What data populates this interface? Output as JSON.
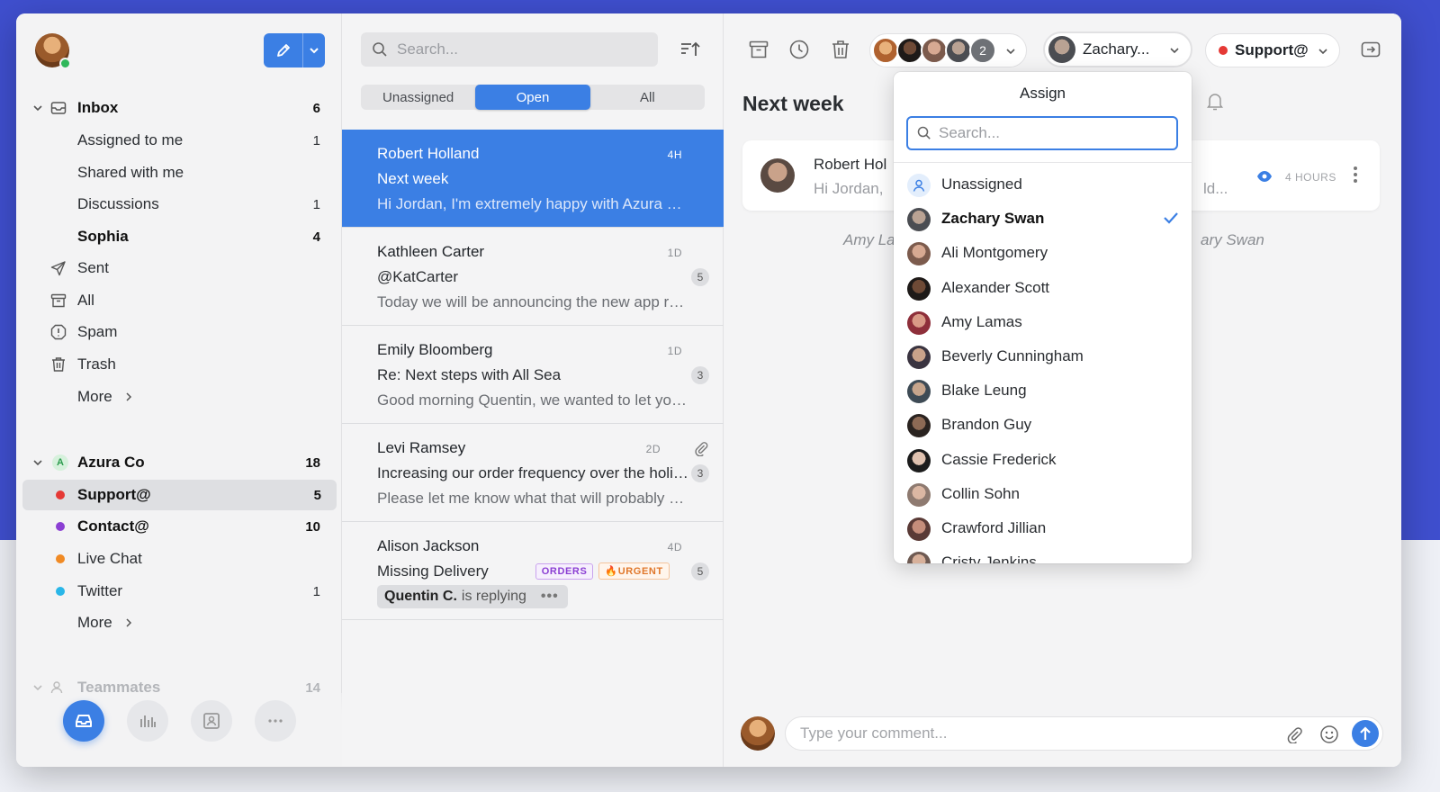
{
  "sidebar": {
    "inbox": {
      "label": "Inbox",
      "count": "6"
    },
    "items": [
      {
        "label": "Assigned to me",
        "count": "1"
      },
      {
        "label": "Shared with me",
        "count": ""
      },
      {
        "label": "Discussions",
        "count": "1"
      },
      {
        "label": "Sophia",
        "count": "4"
      },
      {
        "label": "Sent",
        "count": ""
      },
      {
        "label": "All",
        "count": ""
      },
      {
        "label": "Spam",
        "count": ""
      },
      {
        "label": "Trash",
        "count": ""
      },
      {
        "label": "More",
        "count": ""
      }
    ],
    "org": {
      "badge": "A",
      "label": "Azura Co",
      "count": "18"
    },
    "channels": [
      {
        "label": "Support@",
        "count": "5",
        "color": "#e53935"
      },
      {
        "label": "Contact@",
        "count": "10",
        "color": "#8b3fd3"
      },
      {
        "label": "Live Chat",
        "count": "",
        "color": "#f08a24"
      },
      {
        "label": "Twitter",
        "count": "1",
        "color": "#29b6e8"
      },
      {
        "label": "More",
        "count": ""
      }
    ],
    "teammates": {
      "label": "Teammates",
      "count": "14"
    }
  },
  "list": {
    "search_placeholder": "Search...",
    "tabs": [
      "Unassigned",
      "Open",
      "All"
    ],
    "conversations": [
      {
        "name": "Robert Holland",
        "time": "4H",
        "subject": "Next week",
        "preview": "Hi Jordan, I'm extremely happy with Azura Co and the team",
        "badge": ""
      },
      {
        "name": "Kathleen Carter",
        "time": "1D",
        "subject": "@KatCarter",
        "preview": "Today we will be announcing the new app release",
        "badge": "5"
      },
      {
        "name": "Emily Bloomberg",
        "time": "1D",
        "subject": "Re: Next steps with All Sea",
        "preview": "Good morning Quentin, we wanted to let you know",
        "badge": "3"
      },
      {
        "name": "Levi Ramsey",
        "time": "2D",
        "subject": "Increasing our order frequency over the holidays",
        "preview": "Please let me know what that will probably cost",
        "badge": "3"
      },
      {
        "name": "Alison Jackson",
        "time": "4D",
        "subject": "Missing Delivery",
        "tags": [
          "ORDERS",
          "🔥URGENT"
        ],
        "replying_name": "Quentin C.",
        "replying_text": "is replying",
        "replying_dots": "•••",
        "badge": "5"
      }
    ]
  },
  "main": {
    "avatars_more": "2",
    "assignee_short": "Zachary...",
    "inbox_name": "Support@",
    "title": "Next week",
    "message": {
      "sender": "Robert Hol",
      "preview": "Hi Jordan,",
      "preview_tail": "ld...",
      "time": "4 HOURS"
    },
    "activity_left": "Amy La",
    "activity_right": "ary Swan",
    "composer_placeholder": "Type your comment..."
  },
  "dropdown": {
    "title": "Assign",
    "search_placeholder": "Search...",
    "people": [
      {
        "name": "Unassigned",
        "selected": false
      },
      {
        "name": "Zachary Swan",
        "selected": true
      },
      {
        "name": "Ali Montgomery",
        "selected": false
      },
      {
        "name": "Alexander Scott",
        "selected": false
      },
      {
        "name": "Amy Lamas",
        "selected": false
      },
      {
        "name": "Beverly Cunningham",
        "selected": false
      },
      {
        "name": "Blake Leung",
        "selected": false
      },
      {
        "name": "Brandon Guy",
        "selected": false
      },
      {
        "name": "Cassie Frederick",
        "selected": false
      },
      {
        "name": "Collin Sohn",
        "selected": false
      },
      {
        "name": "Crawford Jillian",
        "selected": false
      },
      {
        "name": "Cristy Jenkins",
        "selected": false
      }
    ]
  },
  "colors": {
    "accent": "#3b7fe4",
    "online": "#2fb75a"
  }
}
